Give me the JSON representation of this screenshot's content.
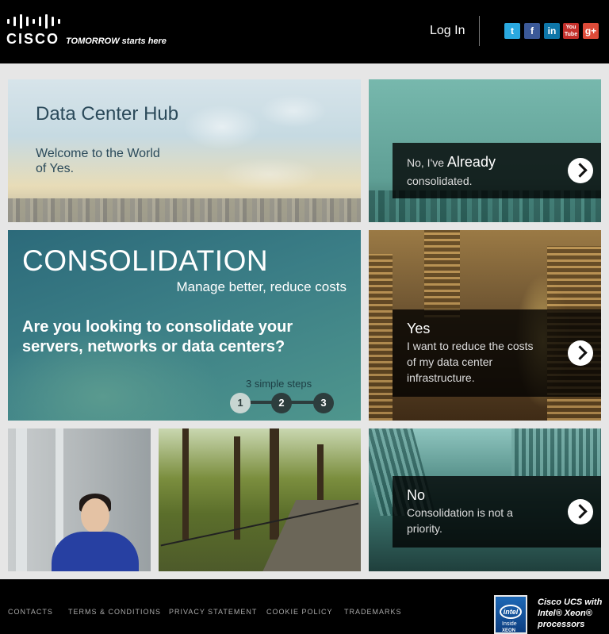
{
  "header": {
    "logo_text": "CISCO",
    "tagline": "TOMORROW starts here",
    "login_label": "Log In",
    "social": [
      {
        "icon": "twitter-icon",
        "glyph": "t",
        "color": "#2aa9e0"
      },
      {
        "icon": "facebook-icon",
        "glyph": "f",
        "color": "#3b5998"
      },
      {
        "icon": "linkedin-icon",
        "glyph": "in",
        "color": "#0e76a8"
      },
      {
        "icon": "youtube-icon",
        "glyph": "You Tube",
        "color": "#c4302b"
      },
      {
        "icon": "google-plus-icon",
        "glyph": "g+",
        "color": "#dd4b39"
      }
    ]
  },
  "hub": {
    "title": "Data Center Hub",
    "subtitle": "Welcome to the World of Yes."
  },
  "already": {
    "line1_prefix": "No, I've",
    "line1_strong": "Already",
    "line2": "consolidated."
  },
  "consolidation": {
    "title": "CONSOLIDATION",
    "subtitle": "Manage better, reduce costs",
    "question": "Are you looking to consolidate your servers, networks or data centers?",
    "steps_label": "3 simple steps",
    "steps": [
      "1",
      "2",
      "3"
    ]
  },
  "yes_panel": {
    "heading": "Yes",
    "text": "I want to reduce the costs of my data center infrastructure."
  },
  "no_panel": {
    "heading": "No",
    "text": "Consolidation is not a priority."
  },
  "footer": {
    "links": [
      "CONTACTS",
      "TERMS & CONDITIONS",
      "PRIVACY STATEMENT",
      "COOKIE POLICY",
      "TRADEMARKS"
    ],
    "intel_logo_text": "intel",
    "intel_inside": "Inside",
    "intel_xeon": "XEON",
    "promo": "Cisco UCS with Intel® Xeon® processors"
  },
  "colors": {
    "header_bg": "#000000",
    "hub_text": "#2b4a5a",
    "consolidation_bg": "#2c6a7a"
  }
}
